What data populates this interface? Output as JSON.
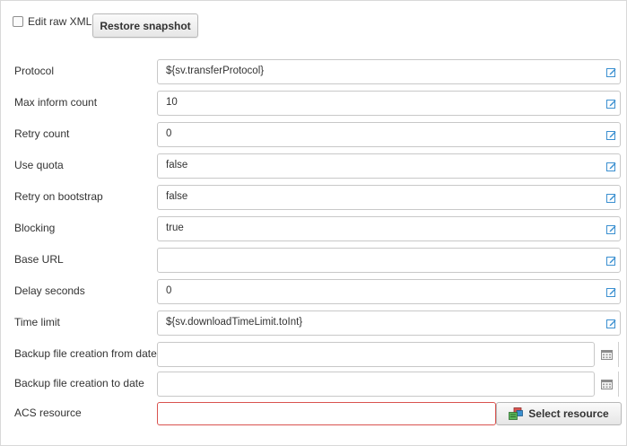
{
  "toolbar": {
    "edit_raw_xml_label": "Edit raw XML",
    "edit_raw_xml_checked": false,
    "restore_snapshot_label": "Restore snapshot"
  },
  "fields": [
    {
      "label": "Protocol",
      "value": "${sv.transferProtocol}"
    },
    {
      "label": "Max inform count",
      "value": "10"
    },
    {
      "label": "Retry count",
      "value": "0"
    },
    {
      "label": "Use quota",
      "value": "false"
    },
    {
      "label": "Retry on bootstrap",
      "value": "false"
    },
    {
      "label": "Blocking",
      "value": "true"
    },
    {
      "label": "Base URL",
      "value": ""
    },
    {
      "label": "Delay seconds",
      "value": "0"
    },
    {
      "label": "Time limit",
      "value": "${sv.downloadTimeLimit.toInt}"
    }
  ],
  "date_fields": [
    {
      "label": "Backup file creation from date",
      "value": ""
    },
    {
      "label": "Backup file creation to date",
      "value": ""
    }
  ],
  "acs": {
    "label": "ACS resource",
    "value": "",
    "select_button_label": "Select resource"
  },
  "colors": {
    "edit_icon": "#3a8fd0",
    "error_border": "#d9534f",
    "border": "#c8c8c8"
  }
}
